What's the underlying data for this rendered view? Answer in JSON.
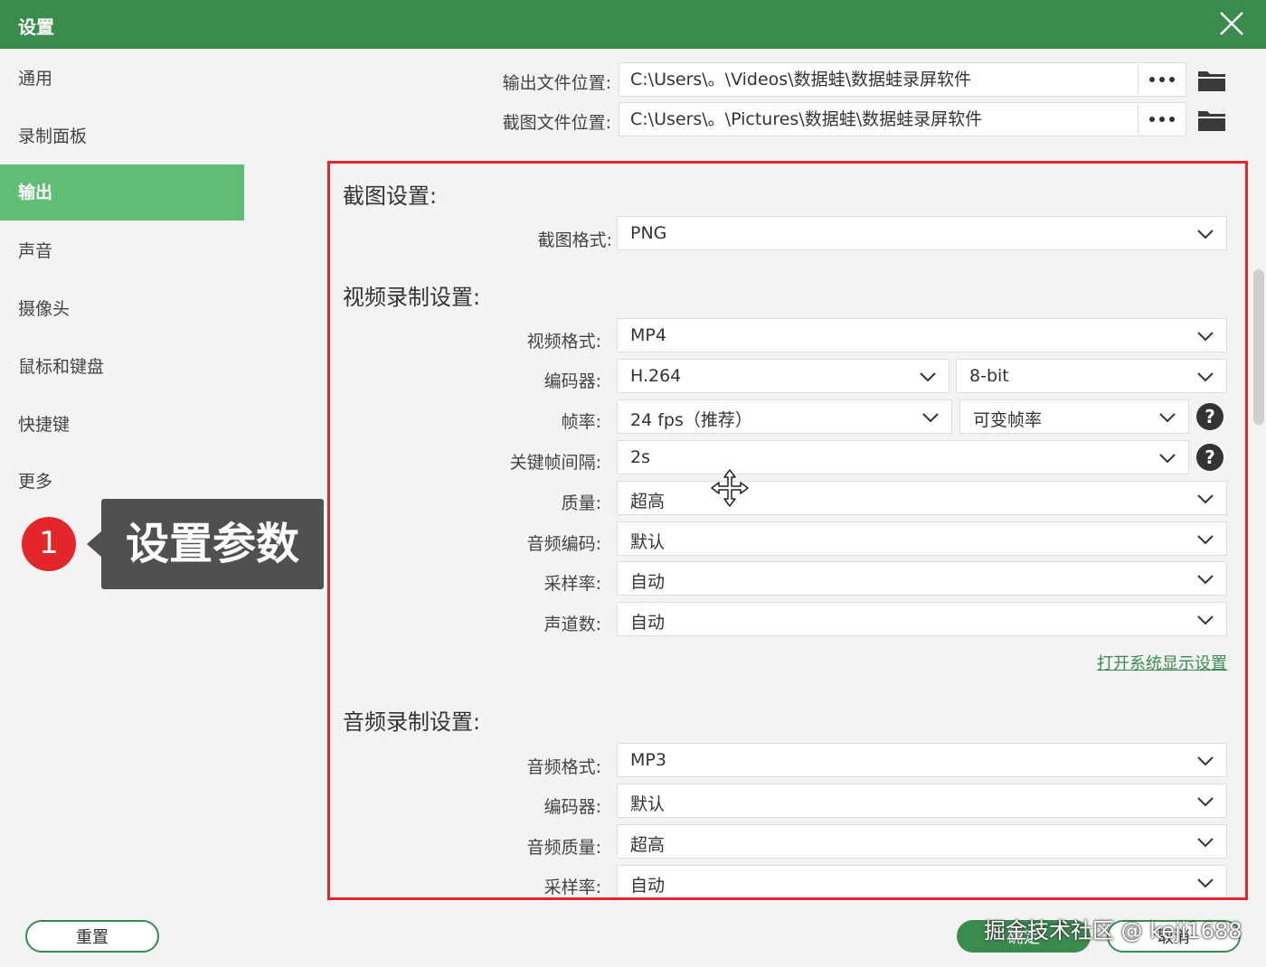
{
  "window": {
    "title": "设置"
  },
  "sidebar": {
    "items": [
      {
        "label": "通用"
      },
      {
        "label": "录制面板"
      },
      {
        "label": "输出"
      },
      {
        "label": "声音"
      },
      {
        "label": "摄像头"
      },
      {
        "label": "鼠标和键盘"
      },
      {
        "label": "快捷键"
      },
      {
        "label": "更多"
      }
    ],
    "active": "输出"
  },
  "callout": {
    "number": "1",
    "text": "设置参数"
  },
  "paths": {
    "output_label": "输出文件位置:",
    "output_value": "C:\\Users\\。\\Videos\\数据蛙\\数据蛙录屏软件",
    "screenshot_label": "截图文件位置:",
    "screenshot_value": "C:\\Users\\。\\Pictures\\数据蛙\\数据蛙录屏软件"
  },
  "screenshot_settings": {
    "title": "截图设置:",
    "format_label": "截图格式:",
    "format_value": "PNG"
  },
  "video_settings": {
    "title": "视频录制设置:",
    "format_label": "视频格式:",
    "format_value": "MP4",
    "encoder_label": "编码器:",
    "encoder_value": "H.264",
    "bitdepth_value": "8-bit",
    "framerate_label": "帧率:",
    "framerate_value": "24 fps（推荐）",
    "framerate_mode": "可变帧率",
    "keyframe_label": "关键帧间隔:",
    "keyframe_value": "2s",
    "quality_label": "质量:",
    "quality_value": "超高",
    "audio_codec_label": "音频编码:",
    "audio_codec_value": "默认",
    "samplerate_label": "采样率:",
    "samplerate_value": "自动",
    "channels_label": "声道数:",
    "channels_value": "自动",
    "display_link": "打开系统显示设置"
  },
  "audio_settings": {
    "title": "音频录制设置:",
    "format_label": "音频格式:",
    "format_value": "MP3",
    "encoder_label": "编码器:",
    "encoder_value": "默认",
    "quality_label": "音频质量:",
    "quality_value": "超高",
    "samplerate_label": "采样率:",
    "samplerate_value": "自动"
  },
  "footer": {
    "reset": "重置",
    "ok": "确定",
    "cancel": "取消",
    "watermark": "掘金技术社区 @ keji1688"
  },
  "help_glyph": "?",
  "colors": {
    "titlebar": "#3a8c4e",
    "active_item": "#5fbd74",
    "highlight": "#e3262a"
  }
}
